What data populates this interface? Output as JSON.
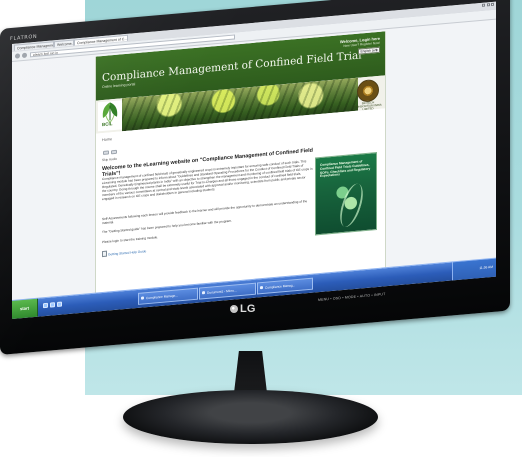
{
  "monitor": {
    "top_brand": "FLATRON",
    "bottom_logo": "LG",
    "control_labels": "MENU • OSD • MODE • AUTO • INPUT"
  },
  "browser": {
    "tabs": [
      "Compliance Management of C...",
      "Welcome...",
      "Compliance Management of C..."
    ],
    "url": "elearn.bcil.nic.in"
  },
  "page": {
    "header": {
      "title": "Compliance Management of Confined Field Trial",
      "subtitle": "Online learning portal",
      "welcome": "Welcome, Login here",
      "links": "New User? Register Now!",
      "language": "English (en)"
    },
    "logos": {
      "left": "BCIL",
      "right_seal_text": "BIOTECH CONSORTIUM INDIA LIMITED"
    },
    "nav": {
      "home": "Home",
      "skip": "Skip Audio"
    },
    "content": {
      "heading": "Welcome to the eLearning website on \"Compliance Management of Confined Field Trials\"!",
      "paragraph_1": "Compliance management of confined field trials of genetically engineered crops is extremely important for ensuring safe conduct of such trials. This eLearning module has been prepared to inform about \"Guidelines and Standard Operating Procedures for the Conduct of Confined Field Trials of Regulated, Genetically Engineered plants in India\" with an objective to strengthen the management and monitoring of confined field trials of GE crops in the country. Going through the course shall be extremely useful for Trial In-Charges and all those engaged in the conduct of confined field trials, members of the various committees at central and state levels associated with approval and/or monitoring, scientists from public and private sector engaged in research on GE crops and stakeholders in general including students.",
      "paragraph_2": "Self-Assessments following each lesson will provide feedback to the learner and will provide the opportunity to demonstrate an understanding of the material.",
      "paragraph_3": "The \"Getting Started guide\" has been prepared to help you become familiar with the program.",
      "paragraph_4": "Please login to start the training module.",
      "guide_link": "Getting Started Help Guide",
      "book_title": "Compliance Management of Confined Field Trials Guidelines, SOPs, Checklists and Regulatory Expectations"
    }
  },
  "taskbar": {
    "start": "start",
    "items": [
      "Compliance Manage...",
      "Document1 - Micro...",
      "Compliance Manag..."
    ],
    "clock": "11:36 AM"
  },
  "colors": {
    "header_green": "#2e5c1d",
    "screen_bg": "#f2f4f7",
    "taskbar_blue": "#2c5db9"
  }
}
